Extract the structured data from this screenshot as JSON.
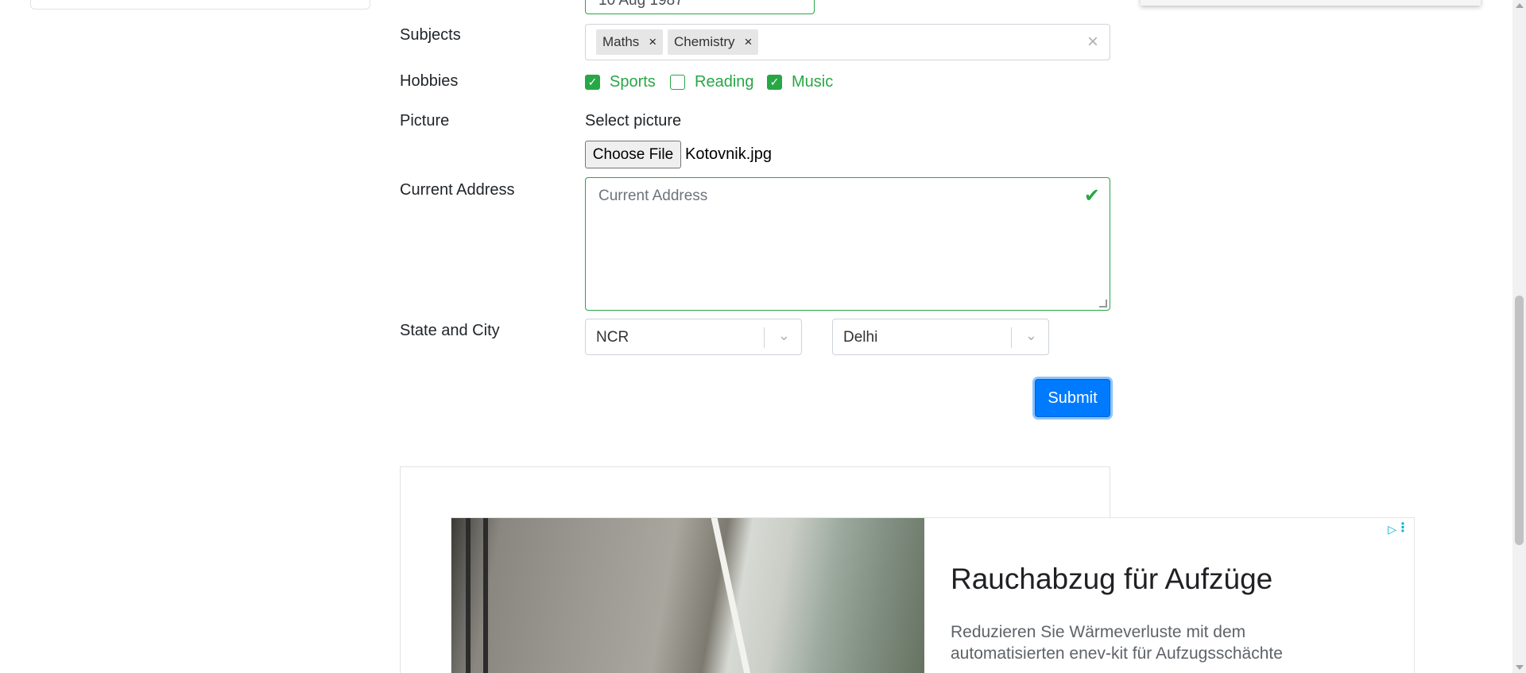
{
  "form": {
    "dob": {
      "value": "10 Aug 1987"
    },
    "subjects": {
      "label": "Subjects",
      "chips": [
        "Maths",
        "Chemistry"
      ],
      "chip_remove": "×",
      "clear": "×"
    },
    "hobbies": {
      "label": "Hobbies",
      "items": [
        {
          "label": "Sports",
          "checked": true
        },
        {
          "label": "Reading",
          "checked": false
        },
        {
          "label": "Music",
          "checked": true
        }
      ]
    },
    "picture": {
      "label": "Picture",
      "caption": "Select picture",
      "button_label": "Choose File",
      "file_name": "Kotovnik.jpg"
    },
    "address": {
      "label": "Current Address",
      "placeholder": "Current Address"
    },
    "state_city": {
      "label": "State and City",
      "state": "NCR",
      "city": "Delhi"
    },
    "submit_label": "Submit"
  },
  "ad": {
    "title": "Rauchabzug für Aufzüge",
    "description": "Reduzieren Sie Wärmeverluste mit dem automatisierten enev-kit für Aufzugsschächte"
  },
  "icons": {
    "check": "✔",
    "checkbox_check": "✓",
    "chevron": "⌄",
    "ad_choices": "▷",
    "ad_menu": "⋮"
  },
  "colors": {
    "success": "#28a745",
    "primary": "#007bff"
  }
}
